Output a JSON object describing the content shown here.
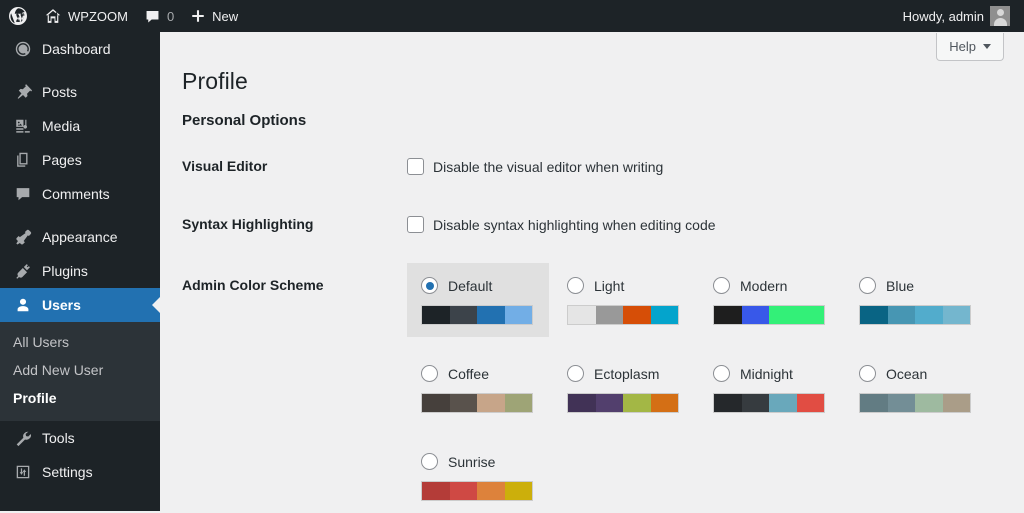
{
  "adminbar": {
    "logo_icon": "wordpress-logo-icon",
    "site_icon": "home-icon",
    "site_name": "WPZOOM",
    "comments_icon": "comment-bubble-icon",
    "comments_count": "0",
    "new_icon": "plus-icon",
    "new_label": "New",
    "howdy": "Howdy, admin",
    "avatar_icon": "user-avatar-icon"
  },
  "sidebar": {
    "items": [
      {
        "label": "Dashboard",
        "icon": "dashboard-gauge-icon",
        "current": false
      },
      {
        "label": "Posts",
        "icon": "pushpin-icon",
        "current": false
      },
      {
        "label": "Media",
        "icon": "media-photo-music-icon",
        "current": false
      },
      {
        "label": "Pages",
        "icon": "pages-stack-icon",
        "current": false
      },
      {
        "label": "Comments",
        "icon": "comment-bubble-icon",
        "current": false
      },
      {
        "label": "Appearance",
        "icon": "paintbrush-icon",
        "current": false
      },
      {
        "label": "Plugins",
        "icon": "plug-icon",
        "current": false
      },
      {
        "label": "Users",
        "icon": "user-icon",
        "current": true
      },
      {
        "label": "Tools",
        "icon": "wrench-icon",
        "current": false
      },
      {
        "label": "Settings",
        "icon": "sliders-icon",
        "current": false
      }
    ],
    "submenu": [
      {
        "label": "All Users",
        "current": false
      },
      {
        "label": "Add New User",
        "current": false
      },
      {
        "label": "Profile",
        "current": true
      }
    ]
  },
  "content": {
    "help_label": "Help",
    "page_title": "Profile",
    "section_title": "Personal Options",
    "rows": {
      "visual_editor": {
        "label": "Visual Editor",
        "checkbox_label": "Disable the visual editor when writing",
        "checked": false
      },
      "syntax_highlighting": {
        "label": "Syntax Highlighting",
        "checkbox_label": "Disable syntax highlighting when editing code",
        "checked": false
      },
      "color_scheme": {
        "label": "Admin Color Scheme"
      }
    },
    "color_schemes": [
      {
        "name": "Default",
        "selected": true,
        "colors": [
          "#1d2327",
          "#3c434a",
          "#2271b1",
          "#72aee6"
        ]
      },
      {
        "name": "Light",
        "selected": false,
        "colors": [
          "#e5e5e5",
          "#999999",
          "#d64e07",
          "#04a4cc"
        ]
      },
      {
        "name": "Modern",
        "selected": false,
        "colors": [
          "#1e1e1e",
          "#3858e9",
          "#33f078",
          "#33f078"
        ]
      },
      {
        "name": "Blue",
        "selected": false,
        "colors": [
          "#096484",
          "#4796b3",
          "#52accc",
          "#74b6ce"
        ]
      },
      {
        "name": "Coffee",
        "selected": false,
        "colors": [
          "#46403c",
          "#59524c",
          "#c7a589",
          "#9ea476"
        ]
      },
      {
        "name": "Ectoplasm",
        "selected": false,
        "colors": [
          "#413256",
          "#523f6d",
          "#a3b745",
          "#d46f15"
        ]
      },
      {
        "name": "Midnight",
        "selected": false,
        "colors": [
          "#25282b",
          "#363b3f",
          "#69a8bb",
          "#e14d43"
        ]
      },
      {
        "name": "Ocean",
        "selected": false,
        "colors": [
          "#627c83",
          "#738e96",
          "#9ebaa0",
          "#aa9d88"
        ]
      },
      {
        "name": "Sunrise",
        "selected": false,
        "colors": [
          "#b43c38",
          "#cf4944",
          "#dd823b",
          "#ccaf0b"
        ]
      }
    ]
  },
  "colors": {
    "accent": "#2271b1",
    "sidebar_bg": "#1d2327",
    "submenu_bg": "#2c3338",
    "content_bg": "#f0f0f1"
  }
}
